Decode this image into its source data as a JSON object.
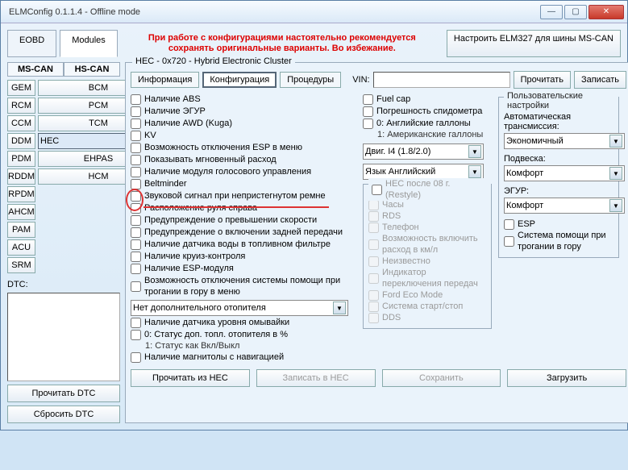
{
  "window": {
    "title": "ELMConfig 0.1.1.4 - Offline mode"
  },
  "topbar": {
    "eobd": "EOBD",
    "modules": "Modules",
    "warning": "При работе с конфигурациями настоятельно рекомендуется сохранять оригинальные варианты. Во избежание.",
    "elm327": "Настроить ELM327 для шины MS-CAN"
  },
  "bus": {
    "ms": "MS-CAN",
    "hs": "HS-CAN"
  },
  "modules_ms": [
    "GEM",
    "RCM",
    "CCM",
    "DDM",
    "PDM",
    "RDDM",
    "RPDM",
    "AHCM",
    "PAM",
    "ACU",
    "SRM"
  ],
  "modules_hs": [
    "BCM",
    "PCM",
    "TCM",
    "HEC",
    "EHPAS",
    "HCM"
  ],
  "selected_module": "HEC",
  "dtc": {
    "label": "DTC:",
    "read": "Прочитать DTC",
    "reset": "Сбросить DTC"
  },
  "panel": {
    "title": "HEC - 0x720 - Hybrid Electronic Cluster",
    "tab_info": "Информация",
    "tab_config": "Конфигурация",
    "tab_proc": "Процедуры",
    "vin_label": "VIN:",
    "vin_value": "",
    "read": "Прочитать",
    "write": "Записать"
  },
  "checks_left": [
    "Наличие ABS",
    "Наличие ЭГУР",
    "Наличие AWD (Kuga)",
    "KV",
    "Возможность отключения ESP в меню",
    "Показывать мгновенный расход",
    "Наличие модуля голосового управления",
    "Beltminder",
    "Звуковой сигнал при непристегнутом ремне",
    "Расположение руля справа",
    "Предупреждение о превышении скорости",
    "Предупреждение о включении задней передачи",
    "Наличие датчика воды в топливном фильтре",
    "Наличие круиз-контроля",
    "Наличие ESP-модуля",
    "Возможность отключения системы помощи при трогании в гору в меню"
  ],
  "heater_select": "Нет дополнительного отопителя",
  "checks_left2": [
    "Наличие датчика уровня омывайки",
    "0: Статус доп. топл. отопителя в %\n1: Статус как Вкл/Выкл",
    "Наличие магнитолы с навигацией"
  ],
  "checks_mid": [
    "Fuel cap",
    "Погрешность спидометра",
    "0: Английские галлоны\n1: Американские галлоны"
  ],
  "engine_select": "Двиг. I4 (1.8/2.0)",
  "lang_select": "Язык Английский",
  "restyle": {
    "title": "HEC после 08 г. (Restyle)",
    "items": [
      "Часы",
      "RDS",
      "Телефон",
      "Возможность включить расход в км/л",
      "Неизвестно",
      "Индикатор переключения передач",
      "Ford Eco Mode",
      "Система старт/стоп",
      "DDS"
    ]
  },
  "usersettings": {
    "title": "Пользовательские настройки",
    "trans_label": "Автоматическая трансмиссия:",
    "trans_value": "Экономичный",
    "susp_label": "Подвеска:",
    "susp_value": "Комфорт",
    "egur_label": "ЭГУР:",
    "egur_value": "Комфорт",
    "esp": "ESP",
    "hill": "Система помощи при трогании в гору"
  },
  "bottom": {
    "read_hec": "Прочитать из HEC",
    "write_hec": "Записать в HEC",
    "save": "Сохранить",
    "load": "Загрузить"
  }
}
